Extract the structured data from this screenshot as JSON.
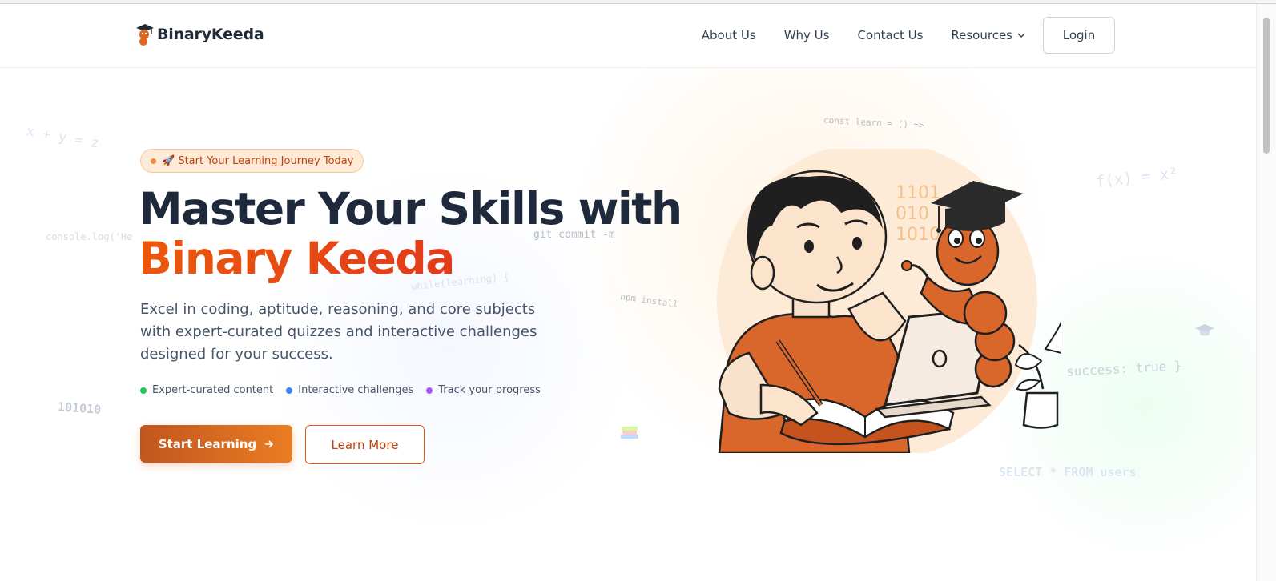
{
  "header": {
    "brand": "BinaryKeeda",
    "nav": [
      "About Us",
      "Why Us",
      "Contact Us",
      "Resources"
    ],
    "login": "Login"
  },
  "hero": {
    "badge": "🚀 Start Your Learning Journey Today",
    "title_line1": "Master Your Skills with",
    "title_line2": "Binary Keeda",
    "description": "Excel in coding, aptitude, reasoning, and core subjects with expert-curated quizzes and interactive challenges designed for your success.",
    "features": [
      {
        "label": "Expert-curated content",
        "color": "#22c55e"
      },
      {
        "label": "Interactive challenges",
        "color": "#3b82f6"
      },
      {
        "label": "Track your progress",
        "color": "#a855f7"
      }
    ],
    "primary_cta": "Start Learning",
    "secondary_cta": "Learn More"
  },
  "decorations": {
    "xyz": "x + y = z",
    "console": "console.log('He",
    "b101010": "101010",
    "git": "git commit -m",
    "while": "while(learning) {",
    "npm": "npm install",
    "const_learn": "const learn = () =>",
    "fx": "f(x) = x²",
    "success": "success: true }",
    "select": "SELECT * FROM users",
    "bin1": "1101",
    "bin2": "010",
    "bin3": "1010"
  },
  "colors": {
    "accent": "#ea580c",
    "accent_dark": "#c2410c",
    "text_dark": "#1e293b"
  }
}
